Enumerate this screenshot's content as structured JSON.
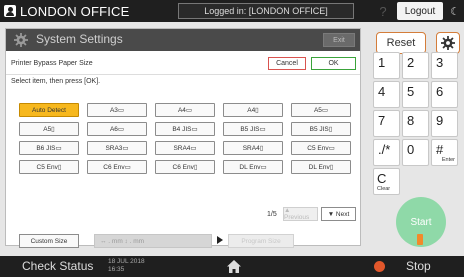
{
  "topbar": {
    "office_name": "LONDON OFFICE",
    "logged_in": "Logged in: [LONDON OFFICE]",
    "help_label": "?",
    "logout_label": "Logout",
    "moon_glyph": "☾"
  },
  "panel": {
    "title": "System Settings",
    "exit_label": "Exit",
    "sub_title": "Printer Bypass Paper Size",
    "cancel_label": "Cancel",
    "ok_label": "OK",
    "instruction": "Select item, then press [OK].",
    "sizes": [
      [
        "Auto Detect",
        "A3▭",
        "A4▭",
        "A4▯",
        "A5▭"
      ],
      [
        "A5▯",
        "A6▭",
        "B4 JIS▭",
        "B5 JIS▭",
        "B5 JIS▯"
      ],
      [
        "B6 JIS▭",
        "SRA3▭",
        "SRA4▭",
        "SRA4▯",
        "C5 Env▭"
      ],
      [
        "C5 Env▯",
        "C6 Env▭",
        "C6 Env▯",
        "DL Env▭",
        "DL Env▯"
      ]
    ],
    "selected_size": "Auto Detect",
    "page_indicator": "1/5",
    "prev_label": "▲ Previous",
    "next_label": "▼ Next",
    "custom_size_label": "Custom Size",
    "custom_field_text": "↔ . mm ↕ . mm",
    "custom_action_label": "Program Size"
  },
  "keypad": {
    "reset_label": "Reset",
    "keys": [
      {
        "label": "1",
        "sub": ""
      },
      {
        "label": "2",
        "sub": ""
      },
      {
        "label": "3",
        "sub": ""
      },
      {
        "label": "4",
        "sub": ""
      },
      {
        "label": "5",
        "sub": ""
      },
      {
        "label": "6",
        "sub": ""
      },
      {
        "label": "7",
        "sub": ""
      },
      {
        "label": "8",
        "sub": ""
      },
      {
        "label": "9",
        "sub": ""
      },
      {
        "label": "./*",
        "sub": ""
      },
      {
        "label": "0",
        "sub": ""
      },
      {
        "label": "#",
        "sub": "Enter"
      },
      {
        "label": "C",
        "sub": "Clear"
      }
    ],
    "start_label": "Start"
  },
  "bottombar": {
    "check_status_label": "Check Status",
    "date": "18 JUL 2018",
    "time": "16:35",
    "stop_label": "Stop"
  },
  "colors": {
    "selected_button": "#f7b81e",
    "start_button": "#8fd9a8",
    "cancel_border": "#d9534f",
    "ok_border": "#3aa33a",
    "reset_border": "#d47d3a"
  }
}
